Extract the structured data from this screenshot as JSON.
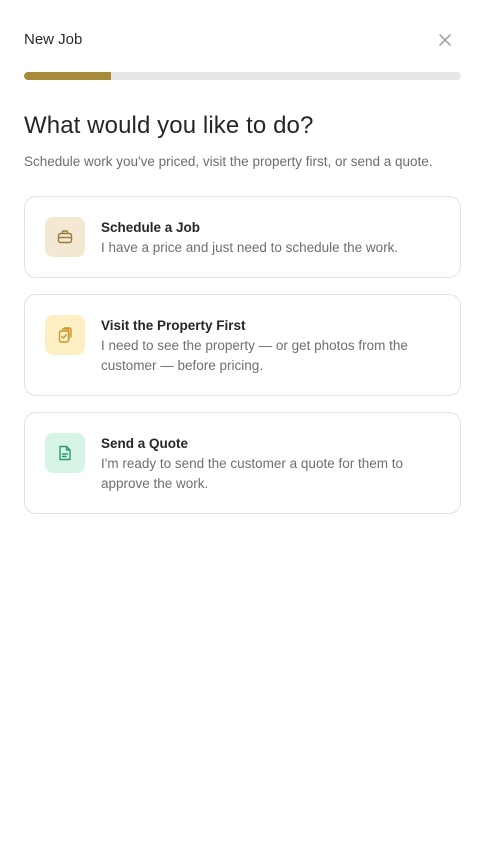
{
  "header": {
    "title": "New Job"
  },
  "progress": {
    "fraction": 0.2
  },
  "main": {
    "heading": "What would you like to do?",
    "subheading": "Schedule work you've priced, visit the property first, or send a quote."
  },
  "options": [
    {
      "title": "Schedule a Job",
      "description": "I have a price and just need to schedule the work.",
      "icon": "briefcase-icon",
      "icon_bg": "#f3e8d2",
      "icon_color": "#9a7a3c"
    },
    {
      "title": "Visit the Property First",
      "description": "I need to see the property — or get photos from the customer — before pricing.",
      "icon": "clipboard-check-icon",
      "icon_bg": "#fdefc4",
      "icon_color": "#c8962b"
    },
    {
      "title": "Send a Quote",
      "description": "I'm ready to send the customer a quote for them to approve the work.",
      "icon": "document-icon",
      "icon_bg": "#d6f5e6",
      "icon_color": "#2f9a63"
    }
  ],
  "colors": {
    "accent": "#a78b3a",
    "track": "#e6e6e6"
  }
}
